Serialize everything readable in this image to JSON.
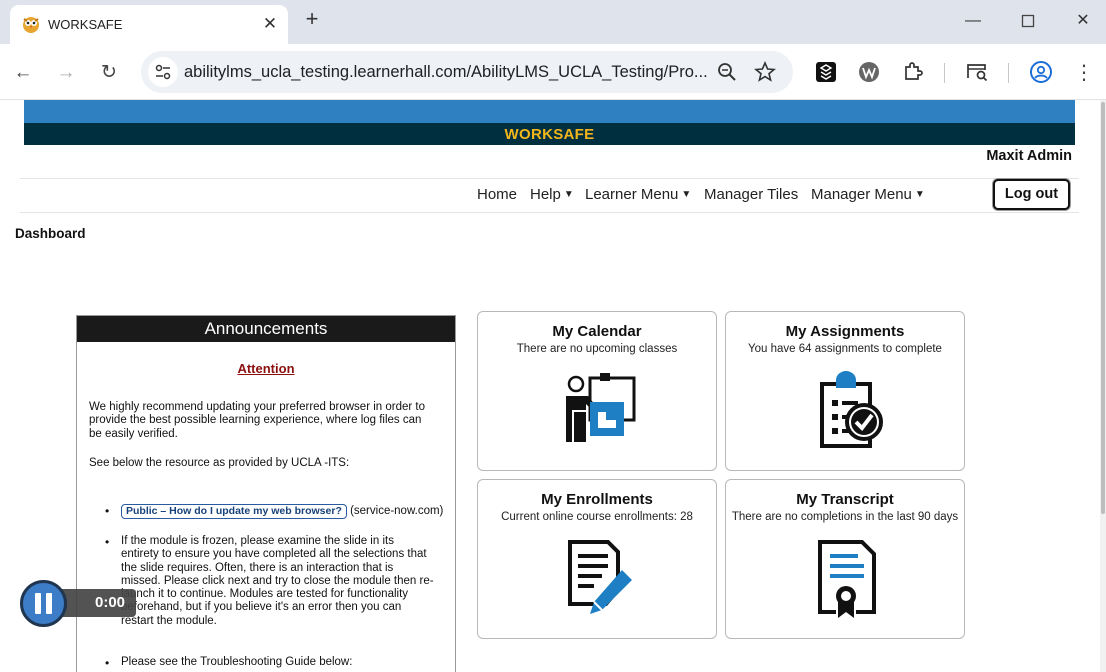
{
  "browser": {
    "tab_title": "WORKSAFE",
    "url": "abilitylms_ucla_testing.learnerhall.com/AbilityLMS_UCLA_Testing/Pro..."
  },
  "site": {
    "brand": "WORKSAFE",
    "user_name": "Maxit Admin",
    "nav": [
      {
        "label": "Home",
        "dropdown": false
      },
      {
        "label": "Help",
        "dropdown": true
      },
      {
        "label": "Learner Menu",
        "dropdown": true
      },
      {
        "label": "Manager Tiles",
        "dropdown": false
      },
      {
        "label": "Manager Menu",
        "dropdown": true
      }
    ],
    "logout_label": "Log out",
    "page_title": "Dashboard"
  },
  "announcements": {
    "heading": "Announcements",
    "attention": "Attention",
    "para1_line1": "We highly recommend updating your preferred browser in order to",
    "para1_line2": "provide the best possible learning experience, where log files can",
    "para1_line3": "be easily verified.",
    "para2": "See below the resource as provided by UCLA -ITS:",
    "link_label": "Public – How do I update my web browser?",
    "link_suffix": "(service-now.com)",
    "bullet2_line1": "If the module is frozen, please examine the slide in its",
    "bullet2_line2": "entirety to ensure you have completed all the selections that",
    "bullet2_line3": "the slide requires. Often, there is an interaction that is",
    "bullet2_line4": "missed. Please click next and try to close the module then re-",
    "bullet2_line5": "launch it to continue. Modules are tested for functionality",
    "bullet2_line6": "beforehand, but if you believe it's an error then you can",
    "bullet2_line7": "restart the module.",
    "bullet3": "Please see the Troubleshooting Guide below:"
  },
  "tiles": {
    "calendar": {
      "title": "My Calendar",
      "subtitle": "There are no upcoming classes",
      "icon": "calendar-presenter-icon"
    },
    "assignments": {
      "title": "My Assignments",
      "subtitle": "You have 64 assignments to complete",
      "icon": "clipboard-check-icon"
    },
    "enrollments": {
      "title": "My Enrollments",
      "subtitle": "Current online course enrollments: 28",
      "icon": "document-pen-icon"
    },
    "transcript": {
      "title": "My Transcript",
      "subtitle": "There are no completions in the last 90 days",
      "icon": "certificate-icon"
    }
  },
  "media": {
    "time": "0:00",
    "state": "paused"
  },
  "colors": {
    "banner_blue": "#2f80c0",
    "banner_dark": "#003040",
    "brand_gold": "#f2b61c",
    "icon_blue": "#1e7fc4",
    "attention_red": "#8b1010"
  }
}
